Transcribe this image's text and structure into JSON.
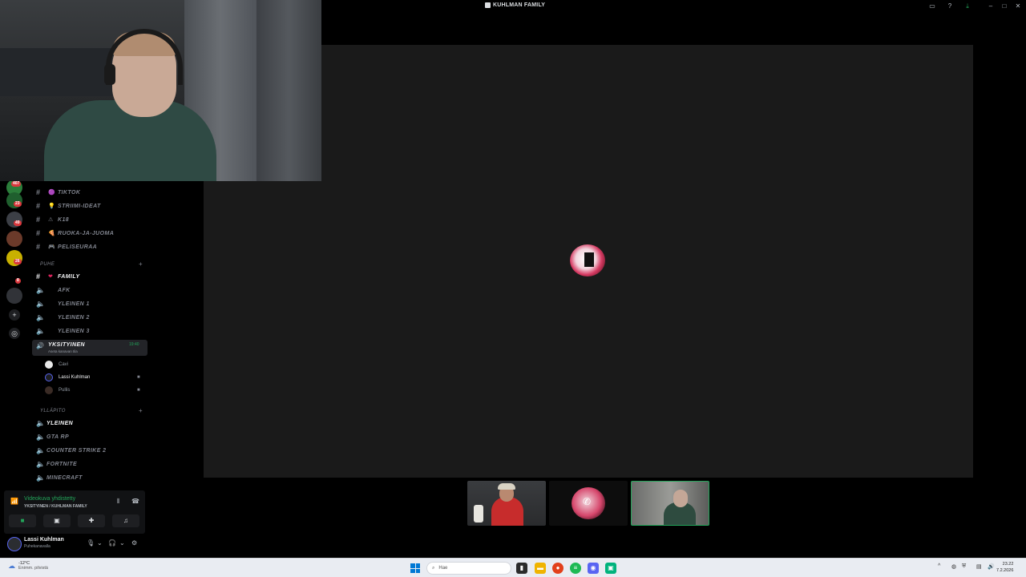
{
  "window": {
    "title": "KUHLMAN FAMILY",
    "icons": [
      "screen-share-icon",
      "help-icon",
      "download-icon",
      "minimize-icon",
      "maximize-icon",
      "close-icon"
    ]
  },
  "rail": {
    "badges": [
      "407",
      "23",
      "49",
      "8",
      "26"
    ]
  },
  "channels": {
    "text": [
      {
        "emoji": "🟣",
        "name": "TIKTOK"
      },
      {
        "emoji": "💡",
        "name": "STRIIMI-IDEAT"
      },
      {
        "emoji": "⚠",
        "name": "K18"
      },
      {
        "emoji": "🍕",
        "name": "RUOKA-JA-JUOMA"
      },
      {
        "emoji": "🎮",
        "name": "PELISEURAA"
      }
    ],
    "category_puhe": "PUHE",
    "family": {
      "emoji": "❤",
      "name": "FAMILY"
    },
    "voice": [
      {
        "name": "AFK"
      },
      {
        "name": "YLEINEN 1"
      },
      {
        "name": "YLEINEN 2"
      },
      {
        "name": "YLEINEN 3"
      }
    ],
    "active_voice": {
      "name": "YKSITYINEN",
      "time": "19:40",
      "sub": "Aseta kanavan tila"
    },
    "voice_users": [
      {
        "name": "Cavi"
      },
      {
        "name": "Lassi Kuhlman"
      },
      {
        "name": "Pullis"
      }
    ],
    "category_yllapito": "YLLÄPITO",
    "yllapito": [
      {
        "name": "YLEINEN"
      },
      {
        "name": "GTA RP"
      },
      {
        "name": "COUNTER STRIKE 2"
      },
      {
        "name": "FORTNITE"
      },
      {
        "name": "MINECRAFT"
      }
    ]
  },
  "voice_panel": {
    "status": "Videokuva yhdistetty",
    "location": "YKSITYINEN / KUHLMAN FAMILY"
  },
  "user_panel": {
    "name": "Lassi Kuhlman",
    "status": "Puhekanavalla"
  },
  "taskbar": {
    "weather_temp": "-12°C",
    "weather_desc": "Enimm. pilvistä",
    "search_placeholder": "Hae",
    "time": "23.22",
    "date": "7.2.2026"
  },
  "colors": {
    "accent_green": "#23a55a",
    "badge_red": "#da373c",
    "stage_bg": "#1a1a1a"
  }
}
